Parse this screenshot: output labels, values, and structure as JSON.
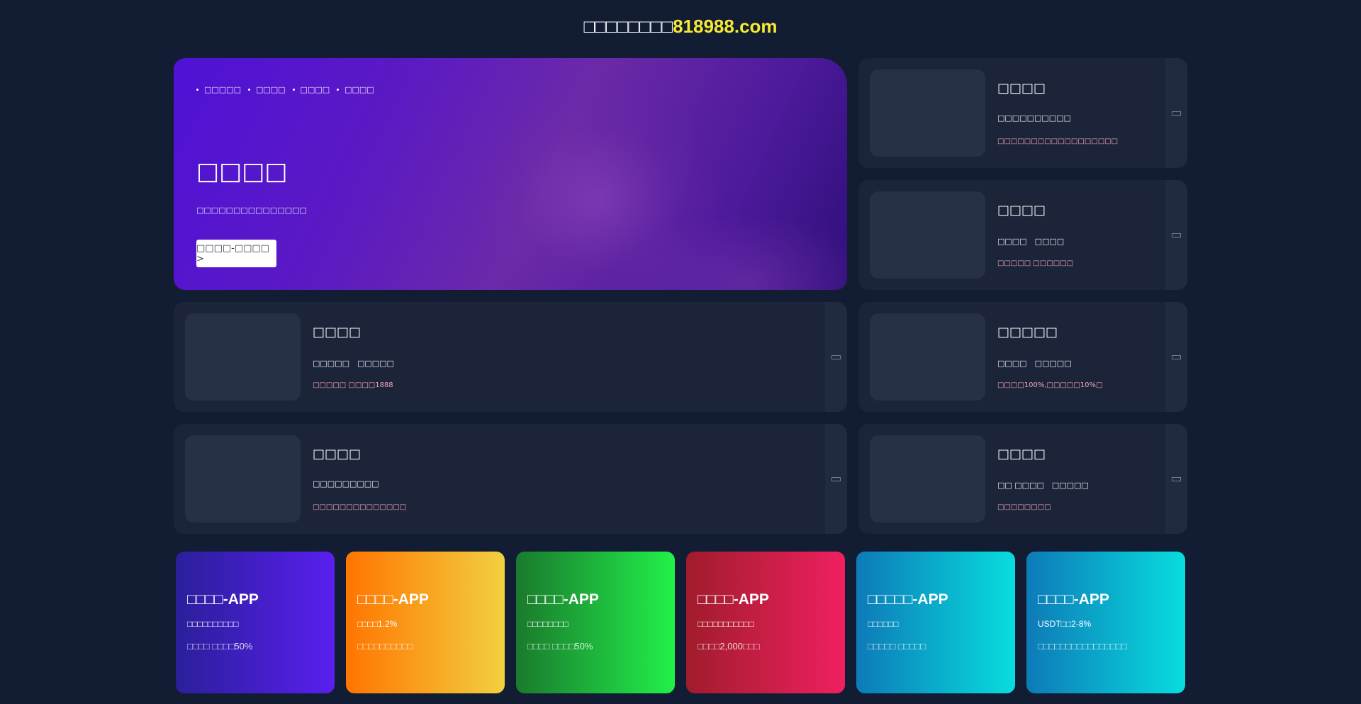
{
  "header": {
    "title_prefix": "□□□□□□□□",
    "title_domain": "818988.com"
  },
  "hero": {
    "nav": [
      "□□□□□",
      "□□□□",
      "□□□□",
      "□□□□"
    ],
    "headline": "□□□□",
    "subtitle": "□□□□□□□□□□□□□□□",
    "button_label": "□□□□-□□□□ >"
  },
  "cards": [
    {
      "title": "□□□□",
      "desc": "□□□□□□□□□□",
      "note": "□□□□□□□□□□□□□□□□□□"
    },
    {
      "title": "□□□□",
      "desc": "□□□□　□□□□",
      "note": "□□□□□ □□□□□□"
    },
    {
      "title": "□□□□",
      "desc": "□□□□□　□□□□□",
      "note": "□□□□□ □□□□1888"
    },
    {
      "title": "□□□□□",
      "desc": "□□□□　□□□□□",
      "note": "□□□□100%,□□□□□10%□"
    },
    {
      "title": "□□□□",
      "desc": "□□□□□□□□□",
      "note": "□□□□□□□□□□□□□□"
    },
    {
      "title": "□□□□",
      "desc": "□□ □□□□　□□□□□",
      "note": "□□□□□□□□"
    }
  ],
  "apps": [
    {
      "title": "□□□□-APP",
      "line1": "□□□□□□□□□□",
      "line2": "□□□□ □□□□50%",
      "color_from": "#2a1f9a",
      "color_to": "#5a1fef"
    },
    {
      "title": "□□□□-APP",
      "line1": "□□□□1.2%",
      "line2": "□□□□□□□□□□",
      "color_from": "#ff7500",
      "color_to": "#f2d040"
    },
    {
      "title": "□□□□-APP",
      "line1": "□□□□□□□□",
      "line2": "□□□□ □□□□50%",
      "color_from": "#1a7a2d",
      "color_to": "#22f04a"
    },
    {
      "title": "□□□□-APP",
      "line1": "□□□□□□□□□□□",
      "line2": "□□□□2,000□□□",
      "color_from": "#a01c2c",
      "color_to": "#f02060"
    },
    {
      "title": "□□□□□-APP",
      "line1": "□□□□□□",
      "line2": "□□□□□ □□□□□",
      "color_from": "#0d7ab8",
      "color_to": "#08dddd"
    },
    {
      "title": "□□□□-APP",
      "line1": "USDT□□2-8%",
      "line2": "□□□□□□□□□□□□□□□□",
      "color_from": "#0d7ab8",
      "color_to": "#08dddd"
    }
  ]
}
